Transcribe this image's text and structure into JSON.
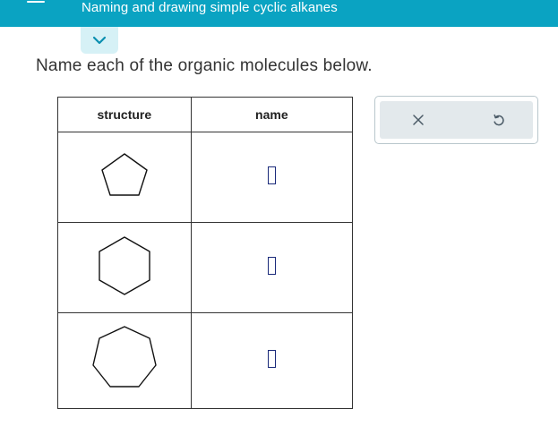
{
  "header": {
    "title": "Naming and drawing simple cyclic alkanes",
    "background_color": "#0aa3c2",
    "menu_icon": "hamburger-menu-icon",
    "collapse_icon": "chevron-down-icon"
  },
  "prompt": "Name each of the organic molecules below.",
  "table": {
    "columns": [
      "structure",
      "name"
    ],
    "rows": [
      {
        "structure_icon": "cyclopentane-pentagon",
        "name_value": ""
      },
      {
        "structure_icon": "cyclohexane-hexagon",
        "name_value": ""
      },
      {
        "structure_icon": "cycloheptane-heptagon",
        "name_value": ""
      }
    ]
  },
  "tools": {
    "clear_icon": "close-icon",
    "undo_icon": "undo-icon"
  }
}
